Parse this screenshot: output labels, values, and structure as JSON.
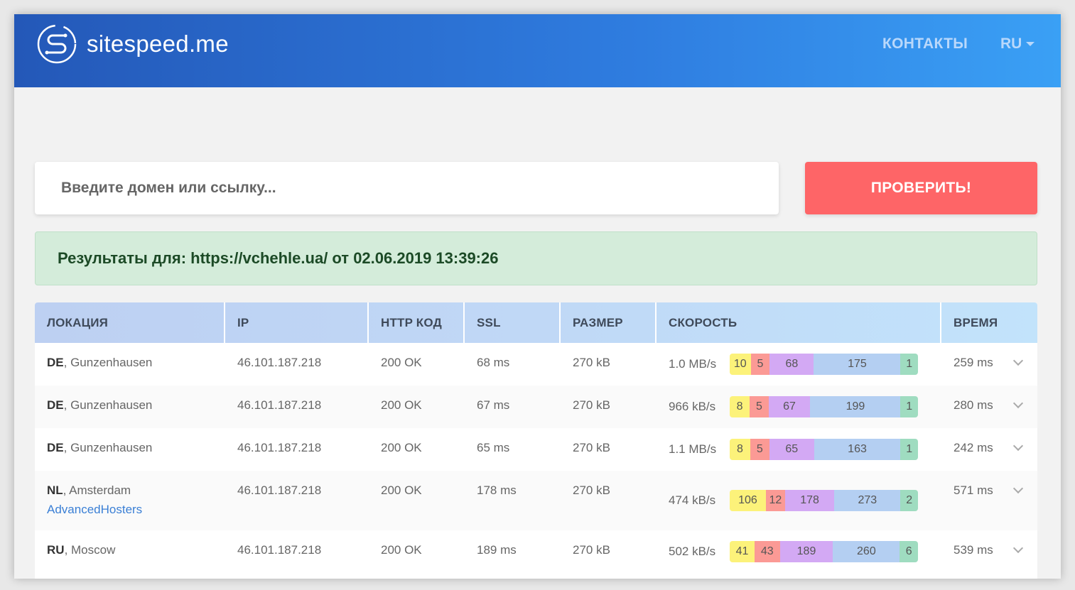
{
  "header": {
    "logo_text": "sitespeed.me",
    "nav_contacts": "КОНТАКТЫ",
    "nav_lang": "RU"
  },
  "search": {
    "placeholder": "Введите домен или ссылку...",
    "button_label": "ПРОВЕРИТЬ!"
  },
  "results": {
    "text": "Результаты для: https://vchehle.ua/ от 02.06.2019 13:39:26"
  },
  "table": {
    "headers": [
      "ЛОКАЦИЯ",
      "IP",
      "HTTP КОД",
      "SSL",
      "РАЗМЕР",
      "СКОРОСТЬ",
      "ВРЕМЯ"
    ],
    "rows": [
      {
        "country": "DE",
        "city": ", Gunzenhausen",
        "hoster": "",
        "ip": "46.101.187.218",
        "http": "200 OK",
        "ssl": "68 ms",
        "size": "270 kB",
        "speed": "1.0 MB/s",
        "segments": [
          "10",
          "5",
          "68",
          "175",
          "1"
        ],
        "time": "259 ms"
      },
      {
        "country": "DE",
        "city": ", Gunzenhausen",
        "hoster": "",
        "ip": "46.101.187.218",
        "http": "200 OK",
        "ssl": "67 ms",
        "size": "270 kB",
        "speed": "966 kB/s",
        "segments": [
          "8",
          "5",
          "67",
          "199",
          "1"
        ],
        "time": "280 ms"
      },
      {
        "country": "DE",
        "city": ", Gunzenhausen",
        "hoster": "",
        "ip": "46.101.187.218",
        "http": "200 OK",
        "ssl": "65 ms",
        "size": "270 kB",
        "speed": "1.1 MB/s",
        "segments": [
          "8",
          "5",
          "65",
          "163",
          "1"
        ],
        "time": "242 ms"
      },
      {
        "country": "NL",
        "city": ", Amsterdam",
        "hoster": "AdvancedHosters",
        "ip": "46.101.187.218",
        "http": "200 OK",
        "ssl": "178 ms",
        "size": "270 kB",
        "speed": "474 kB/s",
        "segments": [
          "106",
          "12",
          "178",
          "273",
          "2"
        ],
        "time": "571 ms"
      },
      {
        "country": "RU",
        "city": ", Moscow",
        "hoster": "",
        "ip": "46.101.187.218",
        "http": "200 OK",
        "ssl": "189 ms",
        "size": "270 kB",
        "speed": "502 kB/s",
        "segments": [
          "41",
          "43",
          "189",
          "260",
          "6"
        ],
        "time": "539 ms"
      }
    ]
  },
  "segment_colors": [
    "#fcf27a",
    "#fb9a95",
    "#d3a9f4",
    "#b4cff2",
    "#9fdcc0"
  ],
  "icons": {
    "logo": "sitespeed-logo-icon",
    "lang_caret": "caret-down-icon",
    "row_expand": "chevron-down-icon"
  }
}
